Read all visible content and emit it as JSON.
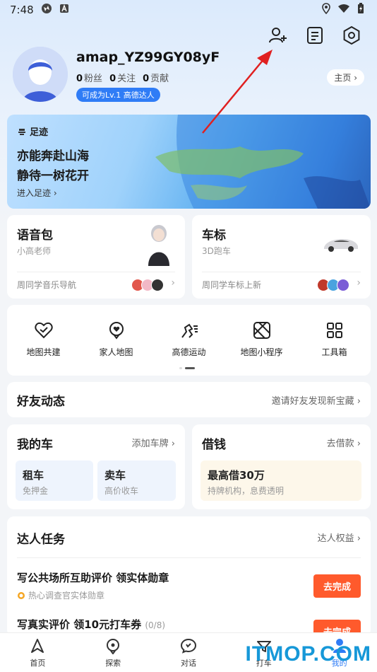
{
  "status_bar": {
    "time": "7:48"
  },
  "header_icons": [
    "add-friend-icon",
    "note-icon",
    "settings-icon"
  ],
  "profile": {
    "username": "amap_YZ99GY08yF",
    "fans": {
      "count": "0",
      "label": "粉丝"
    },
    "follows": {
      "count": "0",
      "label": "关注"
    },
    "contrib": {
      "count": "0",
      "label": "贡献"
    },
    "level_badge": "可成为Lv.1 高德达人",
    "home_button": "主页"
  },
  "footprint": {
    "title": "足迹",
    "line1": "亦能奔赴山海",
    "line2": "静待一树花开",
    "enter": "进入足迹"
  },
  "voice_pack": {
    "title": "语音包",
    "subtitle": "小高老师",
    "footer": "周同学音乐导航"
  },
  "car_icon": {
    "title": "车标",
    "subtitle": "3D跑车",
    "footer": "周同学车标上新"
  },
  "tools": [
    {
      "label": "地图共建",
      "icon": "map-build-icon"
    },
    {
      "label": "家人地图",
      "icon": "family-map-icon"
    },
    {
      "label": "高德运动",
      "icon": "sport-icon"
    },
    {
      "label": "地图小程序",
      "icon": "mini-program-icon"
    },
    {
      "label": "工具箱",
      "icon": "toolbox-icon"
    }
  ],
  "friends": {
    "title": "好友动态",
    "link": "邀请好友发现新宝藏"
  },
  "my_car": {
    "title": "我的车",
    "link": "添加车牌",
    "rent": {
      "title": "租车",
      "sub": "免押金"
    },
    "sell": {
      "title": "卖车",
      "sub": "高价收车"
    }
  },
  "loan": {
    "title": "借钱",
    "link": "去借款",
    "box": {
      "title": "最高借30万",
      "sub": "持牌机构，息费透明"
    }
  },
  "expert_tasks": {
    "title": "达人任务",
    "link": "达人权益",
    "tasks": [
      {
        "title": "写公共场所互助评价 领实体勋章",
        "sub": "热心调查官实体勋章",
        "button": "去完成"
      },
      {
        "title": "写真实评价 领10元打车券",
        "progress": "(0/8)",
        "button": "去完成"
      }
    ]
  },
  "bottom_nav": [
    {
      "label": "首页",
      "icon": "home-icon"
    },
    {
      "label": "探索",
      "icon": "explore-icon"
    },
    {
      "label": "对话",
      "icon": "chat-icon"
    },
    {
      "label": "打车",
      "icon": "taxi-icon"
    },
    {
      "label": "我的",
      "icon": "profile-icon"
    }
  ],
  "watermark": "ITMOP.COM",
  "colors": {
    "accent": "#2f7cf6",
    "task_button": "#ff5a2c",
    "annotation_arrow": "#e02020"
  }
}
